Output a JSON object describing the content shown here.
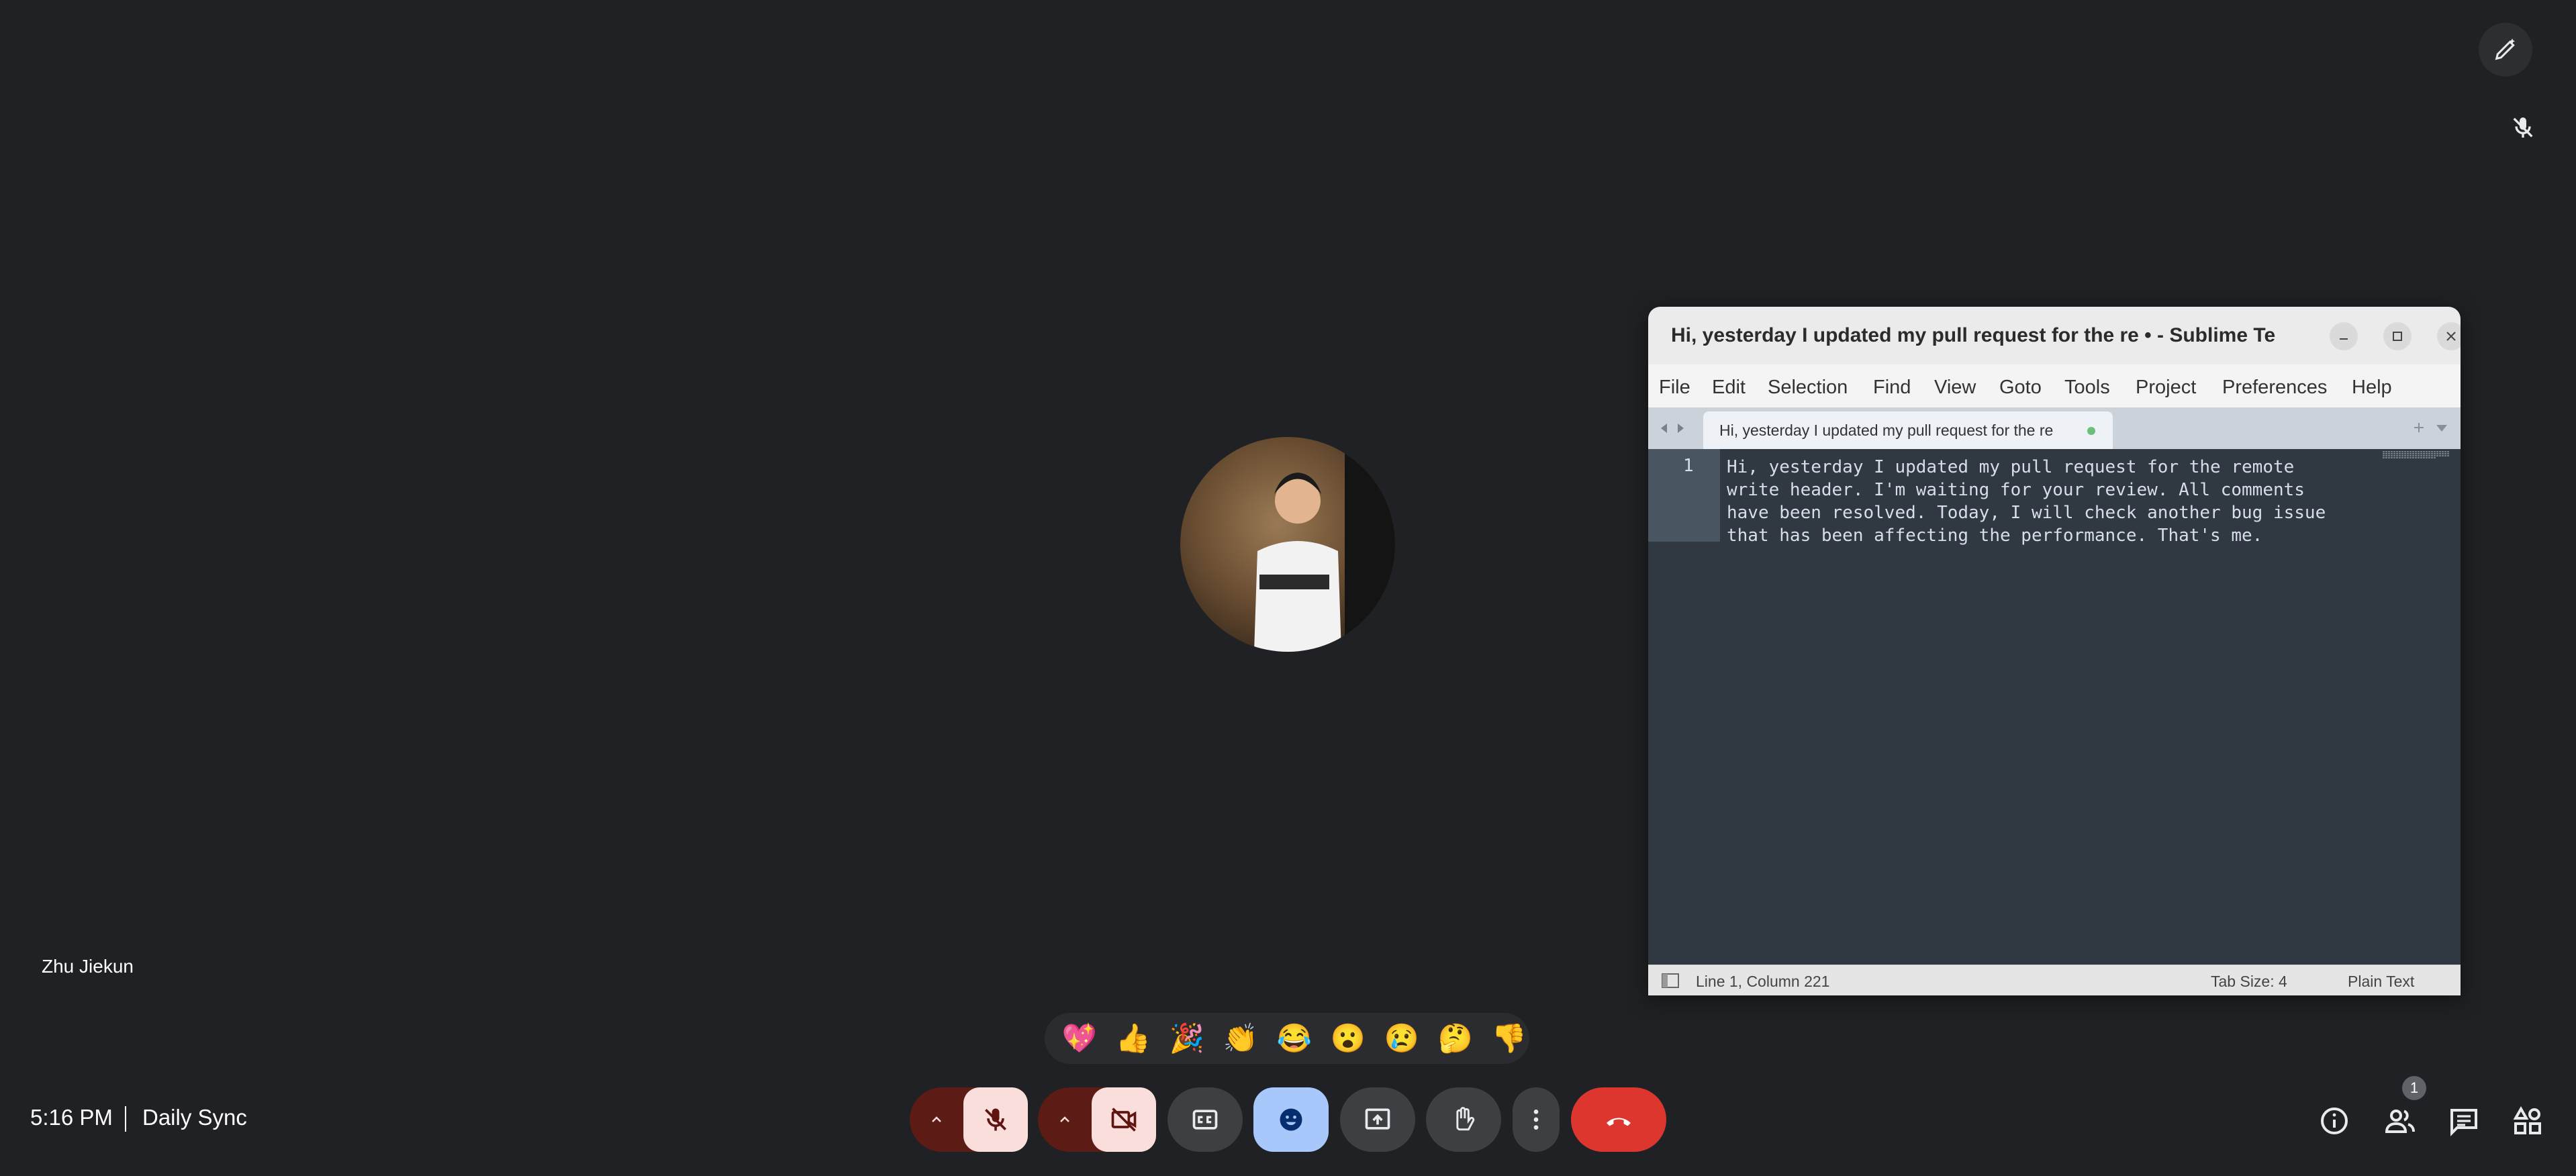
{
  "participant": {
    "name": "Zhu Jiekun"
  },
  "editor": {
    "window_title": "Hi, yesterday I updated my pull request for the re • - Sublime Te...",
    "menu": [
      "File",
      "Edit",
      "Selection",
      "Find",
      "View",
      "Goto",
      "Tools",
      "Project",
      "Preferences",
      "Help"
    ],
    "tab_label": "Hi, yesterday I updated my pull request for the re",
    "line_number": "1",
    "content_lines": [
      "Hi, yesterday I updated my pull request for the remote",
      "write header. I'm waiting for your review. All comments",
      "have been resolved. Today, I will check another bug issue",
      "that has been affecting the performance. That's me."
    ],
    "status": {
      "position": "Line 1, Column 221",
      "tab_size": "Tab Size: 4",
      "syntax": "Plain Text"
    }
  },
  "reactions": [
    "💖",
    "👍",
    "🎉",
    "👏",
    "😂",
    "😮",
    "😢",
    "🤔",
    "👎"
  ],
  "meeting": {
    "time": "5:16 PM",
    "title": "Daily Sync",
    "people_count": "1"
  },
  "colors": {
    "background": "#202124",
    "end_call": "#dc362e",
    "active_button": "#a8c7fa",
    "muted_toggle": "#f9dedc"
  },
  "icons": [
    "pen-icon",
    "mic-off-icon",
    "chevron-up-icon",
    "camera-off-icon",
    "captions-icon",
    "emoji-icon",
    "present-icon",
    "hand-icon",
    "more-vert-icon",
    "call-end-icon",
    "info-icon",
    "people-icon",
    "chat-icon",
    "activities-icon"
  ]
}
